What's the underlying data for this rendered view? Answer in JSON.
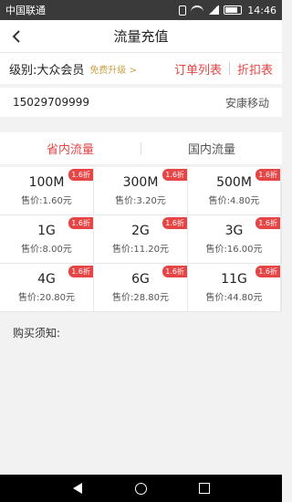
{
  "status_bar": {
    "carrier": "中国联通",
    "time": "14:46"
  },
  "header": {
    "title": "流量充值",
    "back_icon": "chevron-left-icon"
  },
  "member": {
    "level": "级别:大众会员",
    "upgrade": "免费升级 >",
    "order_list": "订单列表",
    "discount_table": "折扣表"
  },
  "phone": {
    "number": "15029709999",
    "carrier": "安康移动"
  },
  "tabs": [
    {
      "label": "省内流量",
      "active": true
    },
    {
      "label": "国内流量",
      "active": false
    }
  ],
  "packages": [
    {
      "size": "100M",
      "price": "售价:1.60元",
      "badge": "1.6折"
    },
    {
      "size": "300M",
      "price": "售价:3.20元",
      "badge": "1.6折"
    },
    {
      "size": "500M",
      "price": "售价:4.80元",
      "badge": "1.6折"
    },
    {
      "size": "1G",
      "price": "售价:8.00元",
      "badge": "1.6折"
    },
    {
      "size": "2G",
      "price": "售价:11.20元",
      "badge": "1.6折"
    },
    {
      "size": "3G",
      "price": "售价:16.00元",
      "badge": "1.6折"
    },
    {
      "size": "4G",
      "price": "售价:20.80元",
      "badge": "1.6折"
    },
    {
      "size": "6G",
      "price": "售价:28.80元",
      "badge": "1.6折"
    },
    {
      "size": "11G",
      "price": "售价:44.80元",
      "badge": "1.6折"
    }
  ],
  "notice": {
    "title": "购买须知:"
  },
  "colors": {
    "accent": "#e64545",
    "upgrade": "#c9a24a"
  }
}
